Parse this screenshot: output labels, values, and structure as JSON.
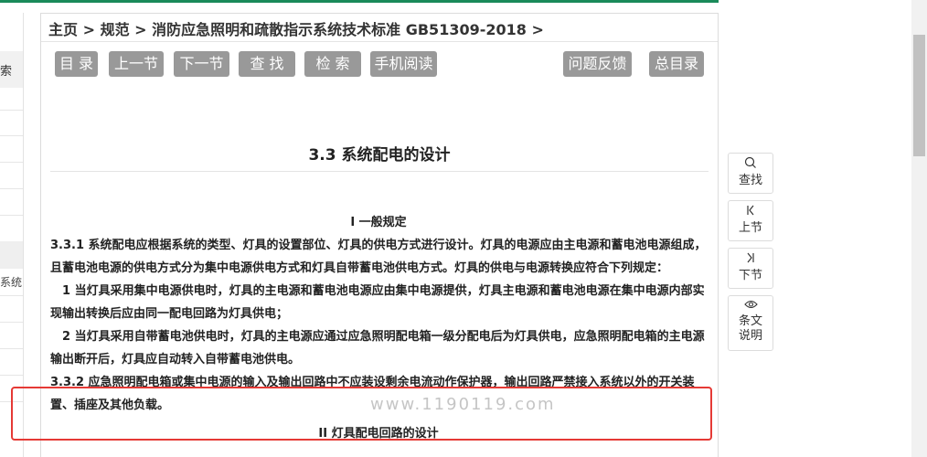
{
  "breadcrumb": {
    "home": "主页",
    "sep": ">",
    "spec": "规范",
    "doc": "消防应急照明和疏散指示系统技术标准 GB51309-2018"
  },
  "toolbar": {
    "contents": "目 录",
    "prev": "上一节",
    "next": "下一节",
    "find": "查 找",
    "search": "检 索",
    "mobile": "手机阅读",
    "feedback": "问题反馈",
    "index": "总目录"
  },
  "section": {
    "title": "3.3  系统配电的设计",
    "sub1": "I 一般规定",
    "p1": "3.3.1 系统配电应根据系统的类型、灯具的设置部位、灯具的供电方式进行设计。灯具的电源应由主电源和蓄电池电源组成，且蓄电池电源的供电方式分为集中电源供电方式和灯具自带蓄电池供电方式。灯具的供电与电源转换应符合下列规定：",
    "p2": "1 当灯具采用集中电源供电时，灯具的主电源和蓄电池电源应由集中电源提供，灯具主电源和蓄电池电源在集中电源内部实现输出转换后应由同一配电回路为灯具供电；",
    "p3": "2 当灯具采用自带蓄电池供电时，灯具的主电源应通过应急照明配电箱一级分配电后为灯具供电，应急照明配电箱的主电源输出断开后，灯具应自动转入自带蓄电池供电。",
    "p4": "3.3.2 应急照明配电箱或集中电源的输入及输出回路中不应装设剩余电流动作保护器，输出回路严禁接入系统以外的开关装置、插座及其他负载。",
    "sub2": "II 灯具配电回路的设计"
  },
  "watermark": "www.1190119.com",
  "left_sidebar": {
    "header": "索",
    "system": "系统"
  },
  "side_nav": {
    "find": "查找",
    "prev": "上节",
    "next": "下节",
    "explain_1": "条文",
    "explain_2": "说明"
  },
  "colors": {
    "accent_bar": "#1a8a5a",
    "button_bg": "#999999",
    "highlight_border": "#e53935"
  }
}
